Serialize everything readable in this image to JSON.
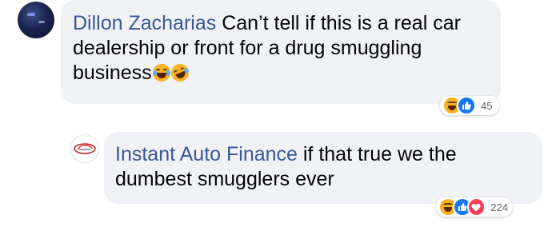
{
  "comment": {
    "author": "Dillon Zacharias",
    "text": "Can’t tell if this is a real car dealership or front for a drug smuggling business",
    "reaction_count": "45"
  },
  "reply": {
    "author": "Instant Auto Finance",
    "text": "if that true we the dumbest smugglers ever",
    "reaction_count": "224"
  },
  "colors": {
    "author": "#385898",
    "bubble": "#f0f2f5",
    "like": "#1877f2",
    "love": "#f33e58",
    "haha": "#f7b125"
  }
}
